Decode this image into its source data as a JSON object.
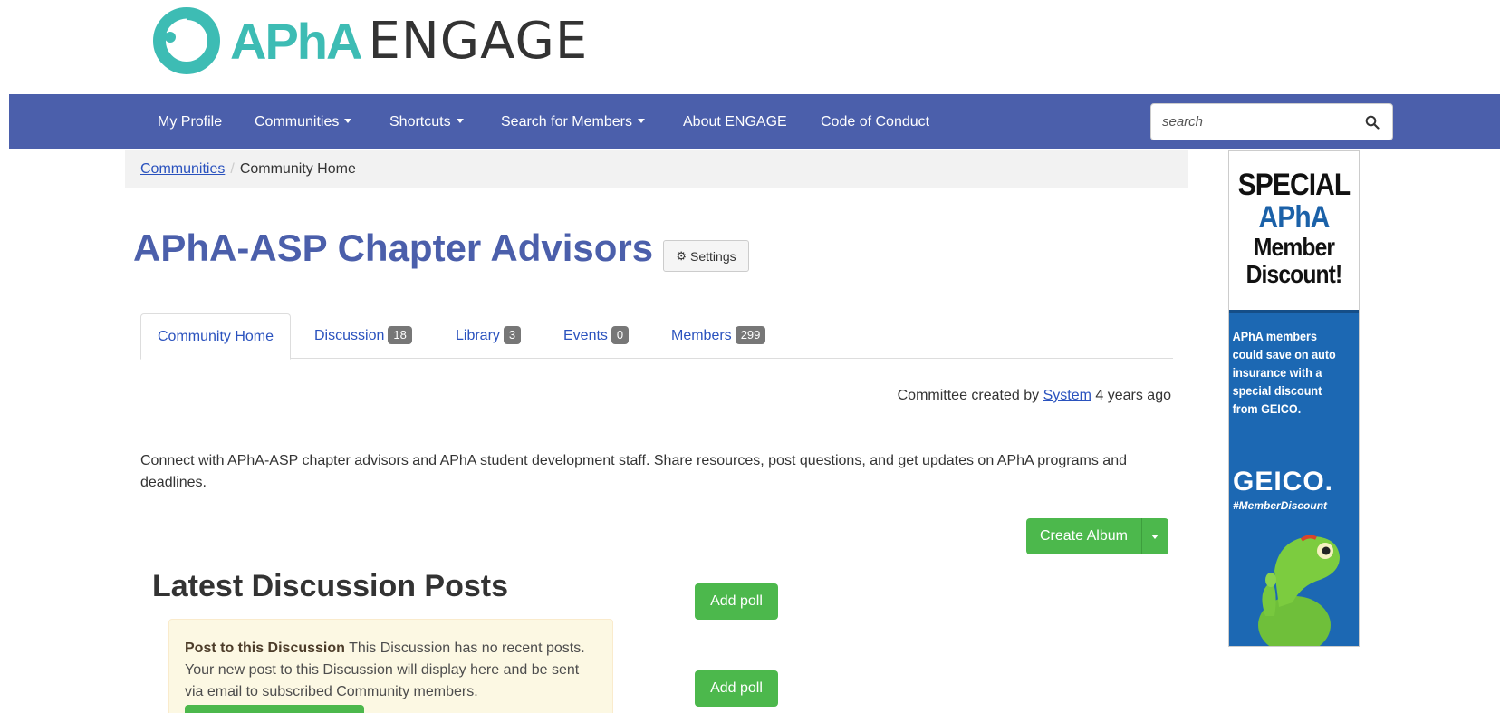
{
  "brand": {
    "name_bold": "APhA",
    "name_light": "ENGAGE"
  },
  "nav": {
    "items": [
      {
        "label": "My Profile",
        "dropdown": false
      },
      {
        "label": "Communities",
        "dropdown": true
      },
      {
        "label": "Shortcuts",
        "dropdown": true
      },
      {
        "label": "Search for Members",
        "dropdown": true
      },
      {
        "label": "About ENGAGE",
        "dropdown": false
      },
      {
        "label": "Code of Conduct",
        "dropdown": false
      }
    ],
    "search_placeholder": "search",
    "search_icon": "search-icon"
  },
  "breadcrumb": {
    "link": "Communities",
    "separator": "/",
    "current": "Community Home"
  },
  "page": {
    "title": "APhA-ASP Chapter Advisors",
    "settings_label": "Settings"
  },
  "tabs": [
    {
      "label": "Community Home",
      "count": null,
      "active": true
    },
    {
      "label": "Discussion",
      "count": "18"
    },
    {
      "label": "Library",
      "count": "3"
    },
    {
      "label": "Events",
      "count": "0"
    },
    {
      "label": "Members",
      "count": "299"
    }
  ],
  "created": {
    "prefix": "Committee created by",
    "user": "System",
    "suffix": "4 years ago"
  },
  "description": "Connect with APhA-ASP chapter advisors and APhA student development staff. Share resources, post questions, and get updates on APhA programs and deadlines.",
  "actions": {
    "create_album": "Create Album",
    "add_poll": "Add poll"
  },
  "discussion": {
    "title": "Latest Discussion Posts",
    "alert_bold": "Post to this Discussion",
    "alert_text": "This Discussion has no recent posts. Your new post to this Discussion will display here and be sent via email to subscribed Community members."
  },
  "ad": {
    "line1": "SPECIAL",
    "line2": "APhA",
    "line3": "Member",
    "line4": "Discount!",
    "body": "APhA members could save on auto insurance with a special discount from GEICO.",
    "brand": "GEICO.",
    "hashtag": "#MemberDiscount"
  },
  "colors": {
    "nav": "#4b5fab",
    "accent_teal": "#3dbcb4",
    "button_green": "#4cb84c",
    "link": "#2a52be",
    "ad_blue": "#1c68b3"
  }
}
